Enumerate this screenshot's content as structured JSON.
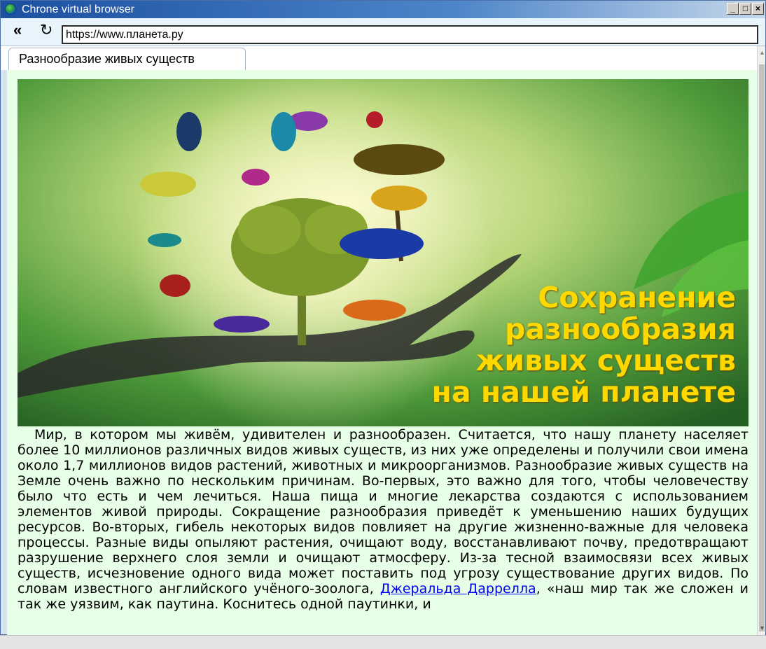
{
  "window": {
    "title": "Chrone virtual browser",
    "buttons": {
      "minimize": "_",
      "maximize": "□",
      "close": "×"
    }
  },
  "nav": {
    "back_icon": "double-chevron-left",
    "reload_icon": "reload",
    "url": "https://www.планета.ру"
  },
  "tabs": [
    {
      "label": "Разнообразие живых существ"
    }
  ],
  "hero": {
    "caption_lines": [
      "Сохранение",
      "разнообразия",
      "живых существ",
      "на нашей планете"
    ],
    "caption_color": "#ffd800"
  },
  "article": {
    "text_before_link": "Мир, в котором мы живём, удивителен и разнообразен. Считается, что нашу планету населяет более 10 миллионов различных видов живых существ, из них уже определены и получили свои имена около 1,7 миллионов видов растений, животных и микроорганизмов. Разнообразие живых существ на Земле очень важно по нескольким причинам. Во-первых, это важно для того, чтобы человечеству было что есть и чем лечиться. Наша пища и многие лекарства создаются с использованием элементов живой природы. Сокращение разнообразия приведёт к уменьшению наших будущих ресурсов. Во-вторых, гибель некоторых видов повлияет на другие жизненно-важные для человека процессы. Разные виды опыляют растения, очищают воду, восстанавливают почву, предотвращают разрушение верхнего слоя земли и очищают атмосферу. Из-за тесной взаимосвязи всех живых существ, исчезновение одного вида может поставить под угрозу существование других видов. По словам известного английского учёного-зоолога,",
    "link_text": "Джеральда Даррелла",
    "text_after_link": ", «наш мир так же сложен и так же уязвим, как паутина. Коснитесь одной паутинки, и"
  },
  "colors": {
    "content_bg": "#e6ffe6",
    "titlebar": "#1b4fa0",
    "link": "#0000ee"
  }
}
